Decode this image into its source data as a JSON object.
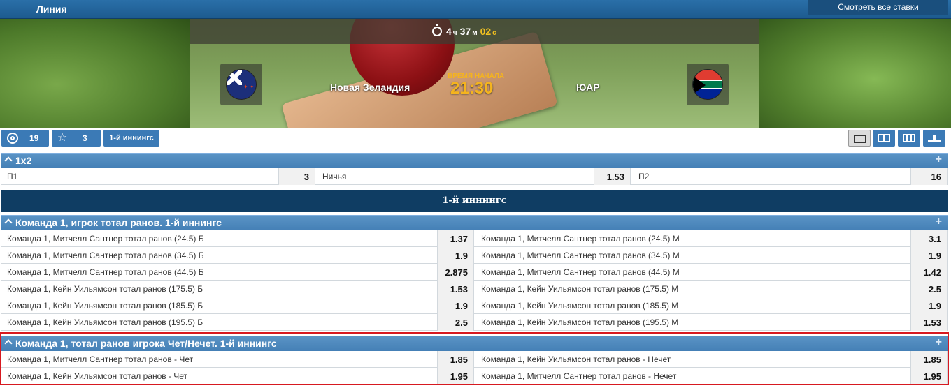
{
  "topbar": {
    "title": "Линия",
    "see_all": "Смотреть все ставки"
  },
  "event": {
    "timer": {
      "hours": "4",
      "h_unit": "ч",
      "minutes": "37",
      "m_unit": "м",
      "seconds": "02",
      "s_unit": "с"
    },
    "team1": "Новая Зеландия",
    "team2": "ЮАР",
    "start_label": "ВРЕМЯ НАЧАЛА",
    "start_time": "21:30"
  },
  "toolbar": {
    "markets_count": "19",
    "favorites_count": "3",
    "innings_button": "1-й иннингс"
  },
  "market_1x2": {
    "title": "1х2",
    "cells": [
      {
        "name": "П1",
        "odd": "3"
      },
      {
        "name": "Ничья",
        "odd": "1.53"
      },
      {
        "name": "П2",
        "odd": "16"
      }
    ]
  },
  "section": {
    "title": "1-й иннингс"
  },
  "market_player_total": {
    "title": "Команда 1, игрок тотал ранов. 1-й иннингс",
    "rows": [
      {
        "left": "Команда 1, Митчелл Сантнер тотал ранов (24.5) Б",
        "left_odd": "1.37",
        "right": "Команда 1, Митчелл Сантнер тотал ранов (24.5) М",
        "right_odd": "3.1"
      },
      {
        "left": "Команда 1, Митчелл Сантнер тотал ранов (34.5) Б",
        "left_odd": "1.9",
        "right": "Команда 1, Митчелл Сантнер тотал ранов (34.5) М",
        "right_odd": "1.9"
      },
      {
        "left": "Команда 1, Митчелл Сантнер тотал ранов (44.5) Б",
        "left_odd": "2.875",
        "right": "Команда 1, Митчелл Сантнер тотал ранов (44.5) М",
        "right_odd": "1.42"
      },
      {
        "left": "Команда 1, Кейн Уильямсон тотал ранов (175.5) Б",
        "left_odd": "1.53",
        "right": "Команда 1, Кейн Уильямсон тотал ранов (175.5) М",
        "right_odd": "2.5"
      },
      {
        "left": "Команда 1, Кейн Уильямсон тотал ранов (185.5) Б",
        "left_odd": "1.9",
        "right": "Команда 1, Кейн Уильямсон тотал ранов (185.5) М",
        "right_odd": "1.9"
      },
      {
        "left": "Команда 1, Кейн Уильямсон тотал ранов (195.5) Б",
        "left_odd": "2.5",
        "right": "Команда 1, Кейн Уильямсон тотал ранов (195.5) М",
        "right_odd": "1.53"
      }
    ]
  },
  "market_odd_even": {
    "title": "Команда 1, тотал ранов игрока Чет/Нечет. 1-й иннингс",
    "rows": [
      {
        "left": "Команда 1, Митчелл Сантнер тотал ранов - Чет",
        "left_odd": "1.85",
        "right": "Команда 1, Кейн Уильямсон тотал ранов - Нечет",
        "right_odd": "1.85"
      },
      {
        "left": "Команда 1, Кейн Уильямсон тотал ранов - Чет",
        "left_odd": "1.95",
        "right": "Команда 1, Митчелл Сантнер тотал ранов - Нечет",
        "right_odd": "1.95"
      }
    ]
  },
  "colors": {
    "header_blue": "#4580b6",
    "section_navy": "#0f3d63",
    "highlight_red": "#d71920",
    "timer_gold": "#f5b41e"
  },
  "icons": {
    "stopwatch": "stopwatch-icon",
    "target": "target-icon",
    "star": "star-icon",
    "collapse": "chevron-up-icon",
    "expand": "plus-icon"
  }
}
